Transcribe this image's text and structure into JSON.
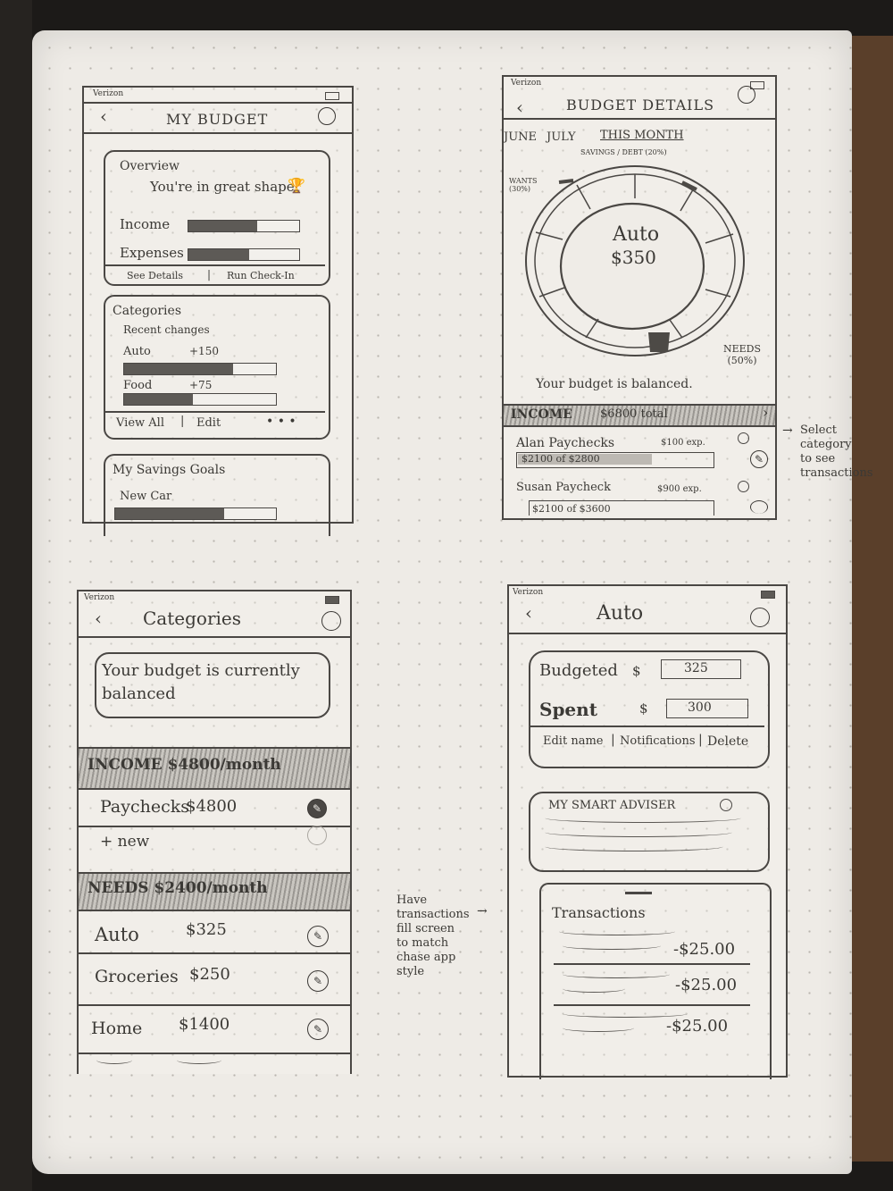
{
  "screen1": {
    "carrier": "Verizon",
    "title": "MY BUDGET",
    "overview": {
      "heading": "Overview",
      "status": "You're in great shape",
      "income_label": "Income",
      "expenses_label": "Expenses",
      "income_fill": 0.62,
      "expenses_fill": 0.55,
      "link_details": "See Details",
      "link_checkin": "Run Check-In"
    },
    "categories": {
      "heading": "Categories",
      "subheading": "Recent changes",
      "item1": "Auto",
      "item1_change": "+150",
      "item2": "Food",
      "item2_change": "+75",
      "item1_fill": 0.72,
      "item2_fill": 0.45,
      "link_view": "View All",
      "link_edit": "Edit",
      "more": "• • •"
    },
    "savings": {
      "heading": "My Savings Goals",
      "item": "New Car",
      "item_fill": 0.68
    }
  },
  "screen2": {
    "carrier": "Verizon",
    "title": "BUDGET DETAILS",
    "months": [
      "JUNE",
      "JULY",
      "THIS MONTH"
    ],
    "labels": {
      "savings": "SAVINGS / DEBT (20%)",
      "wants": "WANTS (30%)",
      "needs": "NEEDS (50%)"
    },
    "center_label": "Auto",
    "center_value": "$350",
    "status": "Your budget is balanced.",
    "income_header": "INCOME",
    "income_total": "$6800 total",
    "rows": [
      {
        "name": "Alan Paychecks",
        "exp": "$100 exp.",
        "progress": "$2100 of $2800"
      },
      {
        "name": "Susan Paycheck",
        "exp": "$900 exp.",
        "progress": "$2100 of $3600"
      }
    ]
  },
  "annotations": {
    "select": "Select\ncategory\nto see\ntransactions",
    "transactions": "Have\ntransactions\nfill screen\nto match\nchase app\nstyle"
  },
  "screen3": {
    "carrier": "Verizon",
    "title": "Categories",
    "banner": "Your budget is currently balanced",
    "income_header": "INCOME $4800/month",
    "income_item": "Paychecks",
    "income_value": "$4800",
    "new_item": "+ new",
    "needs_header": "NEEDS $2400/month",
    "needs_items": [
      {
        "name": "Auto",
        "value": "$325"
      },
      {
        "name": "Groceries",
        "value": "$250"
      },
      {
        "name": "Home",
        "value": "$1400"
      }
    ]
  },
  "screen4": {
    "carrier": "Verizon",
    "title": "Auto",
    "budgeted_label": "Budgeted",
    "budgeted_value": "325",
    "spent_label": "Spent",
    "spent_value": "300",
    "currency": "$",
    "link_edit": "Edit name",
    "link_notify": "Notifications",
    "link_delete": "Delete",
    "adviser_title": "MY SMART ADVISER",
    "transactions_title": "Transactions",
    "transactions": [
      "-$25.00",
      "-$25.00",
      "-$25.00"
    ]
  },
  "colors": {
    "paper": "#eeebe6",
    "pencil": "#3a3836",
    "desk": "#1c1a18"
  }
}
